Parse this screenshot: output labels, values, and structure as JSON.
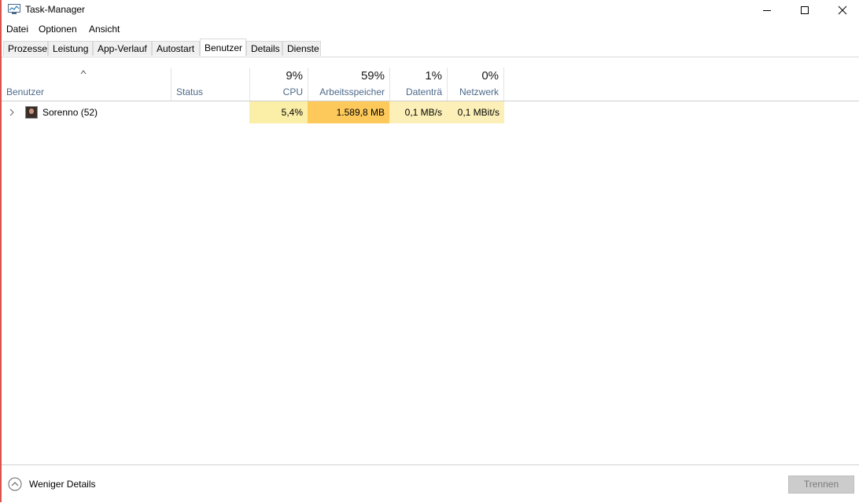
{
  "window": {
    "title": "Task-Manager"
  },
  "menu": {
    "items": [
      "Datei",
      "Optionen",
      "Ansicht"
    ]
  },
  "tabs": [
    "Prozesse",
    "Leistung",
    "App-Verlauf",
    "Autostart",
    "Benutzer",
    "Details",
    "Dienste"
  ],
  "active_tab": "Benutzer",
  "columns": {
    "user": {
      "label": "Benutzer"
    },
    "status": {
      "label": "Status"
    },
    "cpu": {
      "label": "CPU",
      "total": "9%"
    },
    "memory": {
      "label": "Arbeitsspeicher",
      "total": "59%"
    },
    "disk": {
      "label": "Datenträ",
      "total": "1%"
    },
    "network": {
      "label": "Netzwerk",
      "total": "0%"
    }
  },
  "rows": [
    {
      "user": "Sorenno (52)",
      "status": "",
      "cpu": "5,4%",
      "memory": "1.589,8 MB",
      "disk": "0,1 MB/s",
      "network": "0,1 MBit/s"
    }
  ],
  "heat_colors": {
    "light": "#fbeea7",
    "medium": "#fdc95b",
    "pale": "#fcf0b8"
  },
  "footer": {
    "fewer_details": "Weniger Details",
    "disconnect": "Trennen"
  },
  "icons": {
    "app": "task-manager-icon",
    "sort": "sort-ascending-icon",
    "expand": "chevron-right-icon",
    "fewer": "chevron-up-circle-icon"
  }
}
